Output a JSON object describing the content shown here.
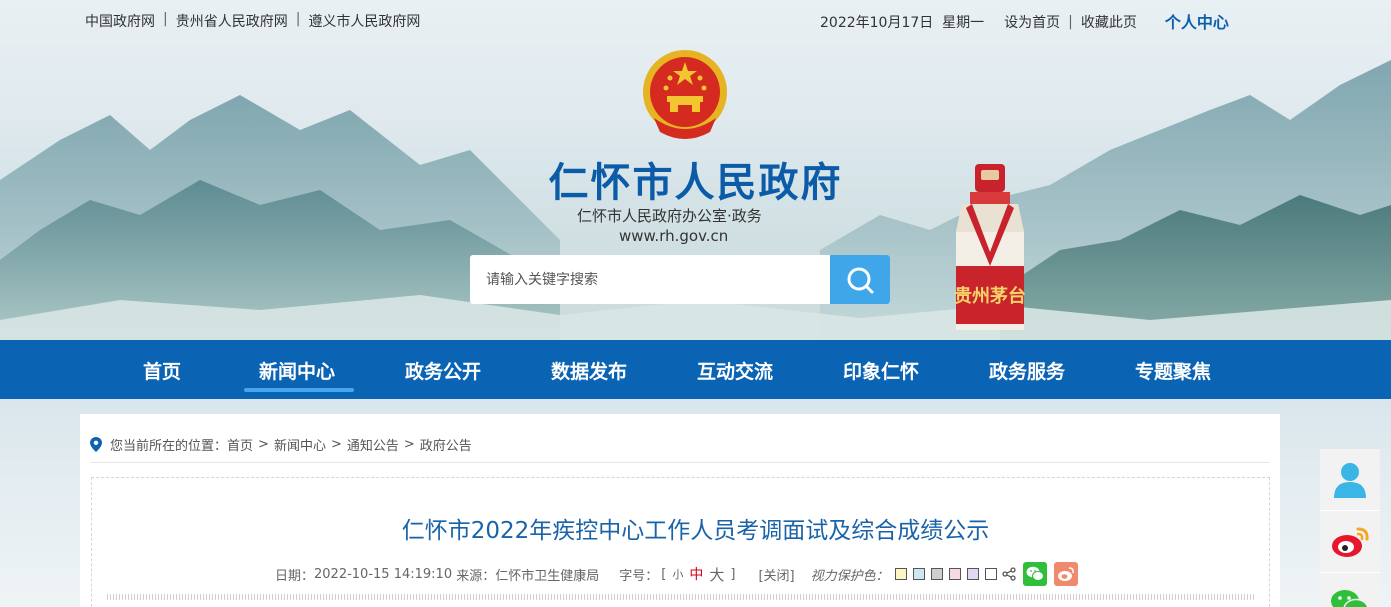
{
  "topbar": {
    "links": [
      "中国政府网",
      "贵州省人民政府网",
      "遵义市人民政府网"
    ],
    "date": "2022年10月17日",
    "weekday": "星期一",
    "set_home": "设为首页",
    "bookmark": "收藏此页",
    "personal_center": "个人中心"
  },
  "site": {
    "title": "仁怀市人民政府",
    "subtitle": "仁怀市人民政府办公室·政务",
    "url": "www.rh.gov.cn",
    "bottle_label": "贵州茅台"
  },
  "search": {
    "placeholder": "请输入关键字搜索"
  },
  "nav": {
    "items": [
      "首页",
      "新闻中心",
      "政务公开",
      "数据发布",
      "互动交流",
      "印象仁怀",
      "政务服务",
      "专题聚焦"
    ],
    "active": "新闻中心"
  },
  "breadcrumb": {
    "prefix": "您当前所在的位置：",
    "items": [
      "首页",
      "新闻中心",
      "通知公告",
      "政府公告"
    ],
    "separator": ">"
  },
  "article": {
    "title": "仁怀市2022年疾控中心工作人员考调面试及综合成绩公示",
    "date_label": "日期：",
    "date": "2022-10-15 14:19:10",
    "source_label": "来源：",
    "source": "仁怀市卫生健康局",
    "font_label": "字号：",
    "bracket_open": "[",
    "bracket_close": "]",
    "font_small": "小",
    "font_mid": "中",
    "font_big": "大",
    "close": "[关闭]",
    "eye_protect": "视力保护色：",
    "swatch_colors": [
      "#fbf6c4",
      "#cfe7f5",
      "#cfcfcf",
      "#f5d9e3",
      "#e2d7f3",
      "#ffffff"
    ]
  },
  "colors": {
    "nav_bg": "#0b63b4",
    "title_blue": "#0c5ba8",
    "accent": "#3fa6ea",
    "wechat": "#2fbf3a",
    "weibo": "#f08a6e"
  },
  "side_icons": [
    "user-icon",
    "weibo-icon",
    "wechat-icon"
  ]
}
